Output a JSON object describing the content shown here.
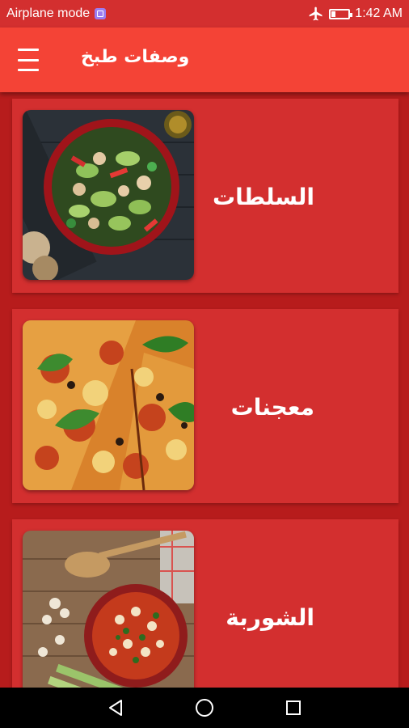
{
  "status_bar": {
    "mode_label": "Airplane mode",
    "time": "1:42 AM",
    "icons": [
      "gallery-icon",
      "airplane-icon",
      "battery-icon"
    ]
  },
  "app_bar": {
    "title": "وصفات طبخ",
    "menu_icon": "hamburger-menu-icon"
  },
  "categories": [
    {
      "label": "السلطات",
      "image": "salad-bowl-photo"
    },
    {
      "label": "معجنات",
      "image": "pizza-photo"
    },
    {
      "label": "الشوربة",
      "image": "bean-soup-photo"
    }
  ],
  "nav_bar": {
    "icons": [
      "back-icon",
      "home-icon",
      "recents-icon"
    ]
  },
  "colors": {
    "status_bar": "#d32f2f",
    "app_bar": "#f44336",
    "list_background": "#b71c1c",
    "card": "#d32f2f",
    "text": "#ffffff"
  }
}
